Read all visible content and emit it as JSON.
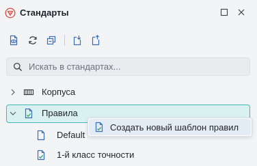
{
  "window": {
    "title": "Стандарты"
  },
  "search": {
    "placeholder": "Искать в стандартах..."
  },
  "tree": {
    "items": [
      {
        "label": "Корпуса",
        "expanded": false
      },
      {
        "label": "Правила",
        "expanded": true,
        "selected": true,
        "children": [
          {
            "label": "Default"
          },
          {
            "label": "1-й класс точности"
          }
        ]
      }
    ]
  },
  "popup": {
    "item_label": "Создать новый шаблон правил"
  },
  "colors": {
    "accent": "#43b7b7",
    "selection_bg": "#d9f1f1",
    "icon_blue": "#3b6db3",
    "brand_red": "#d9534f"
  }
}
